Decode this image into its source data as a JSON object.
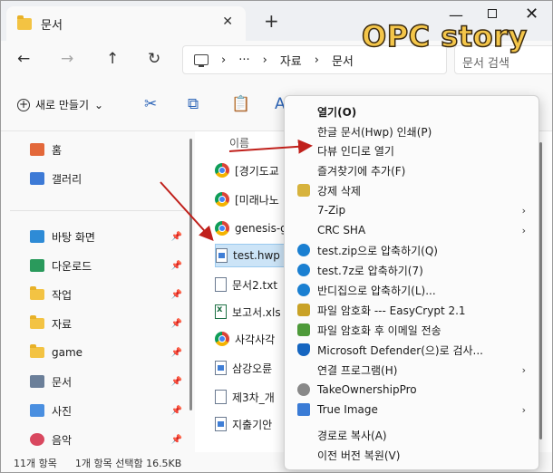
{
  "tab": {
    "label": "문서",
    "close": "✕",
    "add": "+"
  },
  "window_controls": {
    "minimize": "—",
    "maximize": "",
    "close": "✕"
  },
  "watermark": "OPC story",
  "nav": {
    "back": "←",
    "forward": "→",
    "up": "↑",
    "refresh": "↻"
  },
  "address": {
    "more": "···",
    "sep1": "›",
    "sep2": "›",
    "sep3": "›",
    "crumb1": "자료",
    "crumb2": "문서"
  },
  "search": {
    "placeholder": "문서 검색"
  },
  "command_bar": {
    "new_label": "새로 만들기",
    "new_chevron": "⌄",
    "cut": "✂",
    "copy": "⧉",
    "paste": "📋",
    "rename": "A"
  },
  "sidebar": {
    "items": [
      {
        "label": "홈",
        "pinned": false,
        "color": "#e3683a"
      },
      {
        "label": "갤러리",
        "pinned": false,
        "color": "#3d7ad6"
      },
      {
        "label": "바탕 화면",
        "pinned": true,
        "color": "#2e8bd6"
      },
      {
        "label": "다운로드",
        "pinned": true,
        "color": "#2a9a5c"
      },
      {
        "label": "작업",
        "pinned": true,
        "color": "#f3c343"
      },
      {
        "label": "자료",
        "pinned": true,
        "color": "#f3c343"
      },
      {
        "label": "game",
        "pinned": true,
        "color": "#f3c343"
      },
      {
        "label": "문서",
        "pinned": true,
        "color": "#6b7f99"
      },
      {
        "label": "사진",
        "pinned": true,
        "color": "#4a8fe0"
      },
      {
        "label": "음악",
        "pinned": true,
        "color": "#d9485f"
      }
    ],
    "pin_glyph": "📌"
  },
  "file_list": {
    "column_name": "이름",
    "files": [
      {
        "name": "[경기도교",
        "icon": "chrome"
      },
      {
        "name": "[미래나노",
        "icon": "chrome"
      },
      {
        "name": "genesis-g",
        "icon": "chrome"
      },
      {
        "name": "test.hwp",
        "icon": "hwp",
        "selected": true
      },
      {
        "name": "문서2.txt",
        "icon": "doc"
      },
      {
        "name": "보고서.xls",
        "icon": "xls"
      },
      {
        "name": "사각사각",
        "icon": "chrome"
      },
      {
        "name": "삼강오륜",
        "icon": "hwp"
      },
      {
        "name": "제3차_개",
        "icon": "doc"
      },
      {
        "name": "지출기안",
        "icon": "hwp"
      }
    ]
  },
  "status_bar": {
    "count": "11개 항목",
    "selection": "1개 항목 선택함 16.5KB"
  },
  "context_menu": {
    "items": [
      {
        "label": "열기(O)",
        "bold": true,
        "icon": "",
        "submenu": false
      },
      {
        "label": "한글 문서(Hwp) 인쇄(P)",
        "icon": "",
        "submenu": false
      },
      {
        "label": "다뷰 인디로 열기",
        "icon": "",
        "submenu": false
      },
      {
        "label": "즐겨찾기에 추가(F)",
        "icon": "",
        "submenu": false
      },
      {
        "label": "강제 삭제",
        "icon": "key",
        "submenu": false
      },
      {
        "label": "7-Zip",
        "icon": "",
        "submenu": true
      },
      {
        "label": "CRC SHA",
        "icon": "",
        "submenu": true
      },
      {
        "label": "test.zip으로 압축하기(Q)",
        "icon": "bandi",
        "submenu": false
      },
      {
        "label": "test.7z로 압축하기(7)",
        "icon": "bandi",
        "submenu": false
      },
      {
        "label": "반디집으로 압축하기(L)...",
        "icon": "bandi",
        "submenu": false
      },
      {
        "label": "파일 암호화 --- EasyCrypt 2.1",
        "icon": "lock",
        "submenu": false
      },
      {
        "label": "파일 암호화 후 이메일 전송",
        "icon": "mail",
        "submenu": false
      },
      {
        "label": "Microsoft Defender(으)로 검사...",
        "icon": "shield",
        "submenu": false
      },
      {
        "label": "연결 프로그램(H)",
        "icon": "",
        "submenu": true
      },
      {
        "label": "TakeOwnershipPro",
        "icon": "gear",
        "submenu": false
      },
      {
        "label": "True Image",
        "icon": "grid",
        "submenu": true
      },
      {
        "label": "경로로 복사(A)",
        "icon": "",
        "submenu": false
      },
      {
        "label": "이전 버전 복원(V)",
        "icon": "",
        "submenu": false
      }
    ],
    "submenu_glyph": "›"
  },
  "colors": {
    "accent_arrow": "#c0201b",
    "selection": "#cce4f7"
  }
}
